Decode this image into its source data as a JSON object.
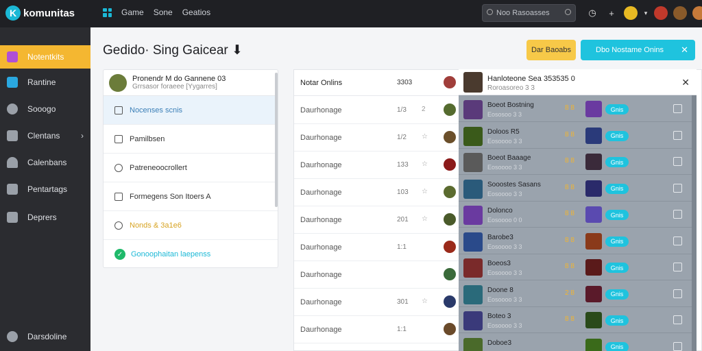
{
  "app": {
    "logo_letter": "K",
    "logo_text": "komunitas"
  },
  "topnav": {
    "items": [
      "Game",
      "Sone",
      "Geatios"
    ]
  },
  "search": {
    "placeholder": "Noo Rasoasses"
  },
  "sidebar": {
    "items": [
      {
        "label": "Notentkits",
        "icon": "controller-icon",
        "active": true
      },
      {
        "label": "Rantine",
        "icon": "home-icon"
      },
      {
        "label": "Sooogo",
        "icon": "chat-icon"
      },
      {
        "label": "Clentans",
        "icon": "folder-icon",
        "chevron": true
      },
      {
        "label": "Calenbans",
        "icon": "person-icon"
      },
      {
        "label": "Pentartags",
        "icon": "archive-icon"
      },
      {
        "label": "Deprers",
        "icon": "layers-icon"
      }
    ],
    "bottom_label": "Darsdoline"
  },
  "page": {
    "title": "Gedido· Sing Gaicear ⬇"
  },
  "buttons": {
    "primary": "Dar Baoabs",
    "secondary": "Dbo Nostame Onins"
  },
  "left_panel": {
    "header_title": "Pronendr M do Gannene 03",
    "header_sub": "Grrsasor foraeee [Yygarres]",
    "rows": [
      {
        "label": "Nocenses scnis",
        "style": "sel"
      },
      {
        "label": "Pamilbsen",
        "style": ""
      },
      {
        "label": "Patreneoocrollert",
        "style": ""
      },
      {
        "label": "Formegens Son Itoers  A",
        "style": ""
      },
      {
        "label": "Nonds & 3a1e6",
        "style": "yellow"
      },
      {
        "label": "Gonoophaitan laepenss",
        "style": "cyan"
      }
    ]
  },
  "main_list": {
    "header_title": "Notar Onlins",
    "header_num": "3303",
    "rows": [
      {
        "name": "Daurhonage",
        "num": "1/3",
        "mark": "2",
        "color": "#556b2f"
      },
      {
        "name": "Daurhonage",
        "num": "1/2",
        "mark": "☆",
        "color": "#6b4f2a"
      },
      {
        "name": "Daurhonage",
        "num": "133",
        "mark": "☆",
        "color": "#8b1a1a"
      },
      {
        "name": "Daurhonage",
        "num": "103",
        "mark": "☆",
        "color": "#5b6b2f"
      },
      {
        "name": "Daurhonage",
        "num": "201",
        "mark": "☆",
        "color": "#4a5a2a"
      },
      {
        "name": "Daurhonage",
        "num": "1:1",
        "mark": "",
        "color": "#9a2a1a"
      },
      {
        "name": "Daurhonage",
        "num": "",
        "mark": "",
        "color": "#3a6a3a"
      },
      {
        "name": "Daurhonage",
        "num": "301",
        "mark": "☆",
        "color": "#2a3a6a"
      },
      {
        "name": "Daurhonage",
        "num": "1:1",
        "mark": "",
        "color": "#6a4a2a"
      }
    ]
  },
  "detail": {
    "title": "Hanloteone Sea 353535 0",
    "sub": "Roroasoreo 3 3",
    "rows": [
      {
        "t1": "Boeot Bostning",
        "t2": "Eososoo 3 3",
        "bdg": "8 8",
        "pill": "Gnis",
        "c1": "#5a3a7a",
        "c2": "#6a3aa0"
      },
      {
        "t1": "Doloos R5",
        "t2": "Eosoooo 3 3",
        "bdg": "8 8",
        "pill": "Gnis",
        "c1": "#3a5a1a",
        "c2": "#2a3a7a"
      },
      {
        "t1": "Boeot Baaage",
        "t2": "Eosoooo 3 3",
        "bdg": "8 8",
        "pill": "Gnis",
        "c1": "#5a5a5a",
        "c2": "#3a2a3a"
      },
      {
        "t1": "Sooostes Sasans",
        "t2": "Eosoooo 3 3",
        "bdg": "8 8",
        "pill": "Gnis",
        "c1": "#2a5a7a",
        "c2": "#2a2a6a"
      },
      {
        "t1": "Dolonco",
        "t2": "Eosoooo 0 0",
        "bdg": "8 8",
        "pill": "Gnis",
        "c1": "#6a3aa0",
        "c2": "#5a4ab0"
      },
      {
        "t1": "Barobe3",
        "t2": "Eosoooo 3 3",
        "bdg": "8 8",
        "pill": "Gnis",
        "c1": "#2a4a8a",
        "c2": "#8a3a1a"
      },
      {
        "t1": "Boeos3",
        "t2": "Eosoooo 3 3",
        "bdg": "8 8",
        "pill": "Gnis",
        "c1": "#7a2a2a",
        "c2": "#5a1a1a"
      },
      {
        "t1": "Doone 8",
        "t2": "Eosoooo 3 3",
        "bdg": "2 8",
        "pill": "Gnis",
        "c1": "#2a6a7a",
        "c2": "#5a1a2a"
      },
      {
        "t1": "Boteo 3",
        "t2": "Eosoooo 3 3",
        "bdg": "8 8",
        "pill": "Gnis",
        "c1": "#3a3a7a",
        "c2": "#2a4a1a"
      },
      {
        "t1": "Doboe3",
        "t2": "",
        "bdg": "",
        "pill": "Gnis",
        "c1": "#4a6a2a",
        "c2": "#3a6a1a"
      }
    ]
  }
}
